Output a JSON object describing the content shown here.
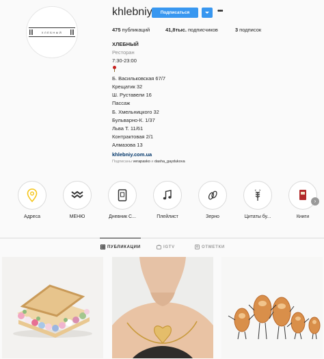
{
  "profile": {
    "username": "khlebniy",
    "follow_label": "Подписаться",
    "more_label": "•••",
    "avatar_logo_text": "ХЛЕБНЫЙ"
  },
  "stats": {
    "posts_count": "475",
    "posts_label": "публикаций",
    "followers_count": "41,8тыс.",
    "followers_label": "подписчиков",
    "following_count": "3",
    "following_label": "подписок"
  },
  "bio": {
    "name": "ХЛЕБНЫЙ",
    "category": "Ресторан",
    "hours": "7:30-23:00",
    "addresses": [
      "Б. Васильковская 67/7",
      "Крещатик 32",
      "Ш. Руставели 16",
      "Пассаж",
      "Б. Хмельницкого 32",
      "Бульварно-К. 1/37",
      "Льва Т. 11/61",
      "Контрактовая 2/1",
      "Алмазова 13"
    ],
    "website": "khlebniy.com.ua",
    "followed_by_prefix": "Подписаны",
    "followed_by_user1": "verapasko",
    "followed_by_and": "и",
    "followed_by_user2": "dasha_gaydukova"
  },
  "highlights": [
    {
      "label": "Адреса",
      "icon": "map-pin-icon"
    },
    {
      "label": "МЕНЮ",
      "icon": "wheat-pattern-icon"
    },
    {
      "label": "Дневник С...",
      "icon": "diary-icon"
    },
    {
      "label": "Плейлист",
      "icon": "music-note-icon"
    },
    {
      "label": "Зерно",
      "icon": "grain-icon"
    },
    {
      "label": "Цитаты бу...",
      "icon": "wheat-ear-icon"
    },
    {
      "label": "Книги",
      "icon": "book-icon"
    }
  ],
  "tabs": [
    {
      "label": "ПУБЛИКАЦИИ",
      "active": true
    },
    {
      "label": "IGTV",
      "active": false
    },
    {
      "label": "ОТМЕТКИ",
      "active": false
    }
  ],
  "posts": [
    {
      "alt": "flower-sandwich-photo"
    },
    {
      "alt": "bread-pendant-necklace-photo"
    },
    {
      "alt": "croissant-figures-photo"
    }
  ],
  "colors": {
    "accent": "#3897f0",
    "link": "#003569",
    "muted": "#8e8e8e",
    "pin_icon": "#f5c518"
  }
}
